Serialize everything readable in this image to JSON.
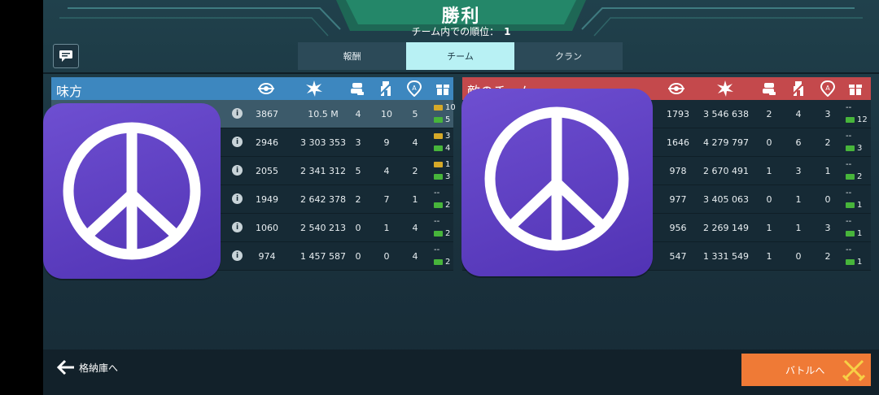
{
  "header": {
    "title": "勝利",
    "rank_label": "チーム内での順位：",
    "rank_value": "1"
  },
  "tabs": [
    {
      "label": "報酬",
      "active": false
    },
    {
      "label": "チーム",
      "active": true
    },
    {
      "label": "クラン",
      "active": false
    }
  ],
  "left_team": {
    "name": "味方",
    "color": "#3d87bf",
    "rows": [
      {
        "score": "3867",
        "damage": "10.5 M",
        "assists": "4",
        "kills": "10",
        "captures": "5",
        "reward_gold": "10",
        "reward_green": "5",
        "highlight": true
      },
      {
        "score": "2946",
        "damage": "3 303 353",
        "assists": "3",
        "kills": "9",
        "captures": "4",
        "reward_gold": "3",
        "reward_green": "4",
        "highlight": false
      },
      {
        "score": "2055",
        "damage": "2 341 312",
        "assists": "5",
        "kills": "4",
        "captures": "2",
        "reward_gold": "1",
        "reward_green": "3",
        "highlight": false
      },
      {
        "score": "1949",
        "damage": "2 642 378",
        "assists": "2",
        "kills": "7",
        "captures": "1",
        "reward_gold": "--",
        "reward_green": "2",
        "highlight": false
      },
      {
        "score": "1060",
        "damage": "2 540 213",
        "assists": "0",
        "kills": "1",
        "captures": "4",
        "reward_gold": "--",
        "reward_green": "2",
        "highlight": false
      },
      {
        "score": "974",
        "damage": "1 457 587",
        "assists": "0",
        "kills": "0",
        "captures": "4",
        "reward_gold": "--",
        "reward_green": "2",
        "highlight": false
      }
    ]
  },
  "right_team": {
    "name": "敵のチーム",
    "color": "#c4494c",
    "rows": [
      {
        "score": "1793",
        "damage": "3 546 638",
        "assists": "2",
        "kills": "4",
        "captures": "3",
        "reward_gold": "--",
        "reward_green": "12"
      },
      {
        "score": "1646",
        "damage": "4 279 797",
        "assists": "0",
        "kills": "6",
        "captures": "2",
        "reward_gold": "--",
        "reward_green": "3"
      },
      {
        "score": "978",
        "damage": "2 670 491",
        "assists": "1",
        "kills": "3",
        "captures": "1",
        "reward_gold": "--",
        "reward_green": "2"
      },
      {
        "score": "977",
        "damage": "3 405 063",
        "assists": "0",
        "kills": "1",
        "captures": "0",
        "reward_gold": "--",
        "reward_green": "1"
      },
      {
        "score": "956",
        "damage": "2 269 149",
        "assists": "1",
        "kills": "1",
        "captures": "3",
        "reward_gold": "--",
        "reward_green": "1"
      },
      {
        "score": "547",
        "damage": "1 331 549",
        "assists": "1",
        "kills": "0",
        "captures": "2",
        "reward_gold": "--",
        "reward_green": "1"
      }
    ]
  },
  "icons": {
    "chat": "chat-icon",
    "score": "score-icon",
    "damage": "damage-burst-icon",
    "assist": "assist-fist-icon",
    "kills": "robot-kill-icon",
    "capture": "beacon-capture-icon",
    "reward": "gift-icon",
    "info": "info-icon",
    "overlay": "peace-sign-icon"
  },
  "footer": {
    "back_label": "格納庫へ",
    "battle_label": "バトルへ"
  },
  "colors": {
    "accent": "#b8f1f4",
    "battle_button": "#ef7a36",
    "peace_bg": "#5a3cc0"
  }
}
